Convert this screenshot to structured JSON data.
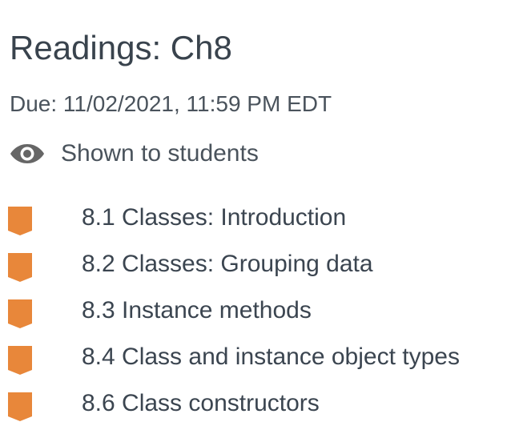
{
  "assignment": {
    "title": "Readings: Ch8",
    "due": "Due: 11/02/2021, 11:59 PM EDT",
    "visibility": {
      "icon": "eye-icon",
      "label": "Shown to students"
    }
  },
  "colors": {
    "bookmark": "#e8873a",
    "text": "#3b4550",
    "icon": "#666666"
  },
  "items": [
    {
      "icon": "bookmark-icon",
      "label": "8.1 Classes: Introduction"
    },
    {
      "icon": "bookmark-icon",
      "label": "8.2 Classes: Grouping data"
    },
    {
      "icon": "bookmark-icon",
      "label": "8.3 Instance methods"
    },
    {
      "icon": "bookmark-icon",
      "label": "8.4 Class and instance object types"
    },
    {
      "icon": "bookmark-icon",
      "label": "8.6 Class constructors"
    }
  ]
}
